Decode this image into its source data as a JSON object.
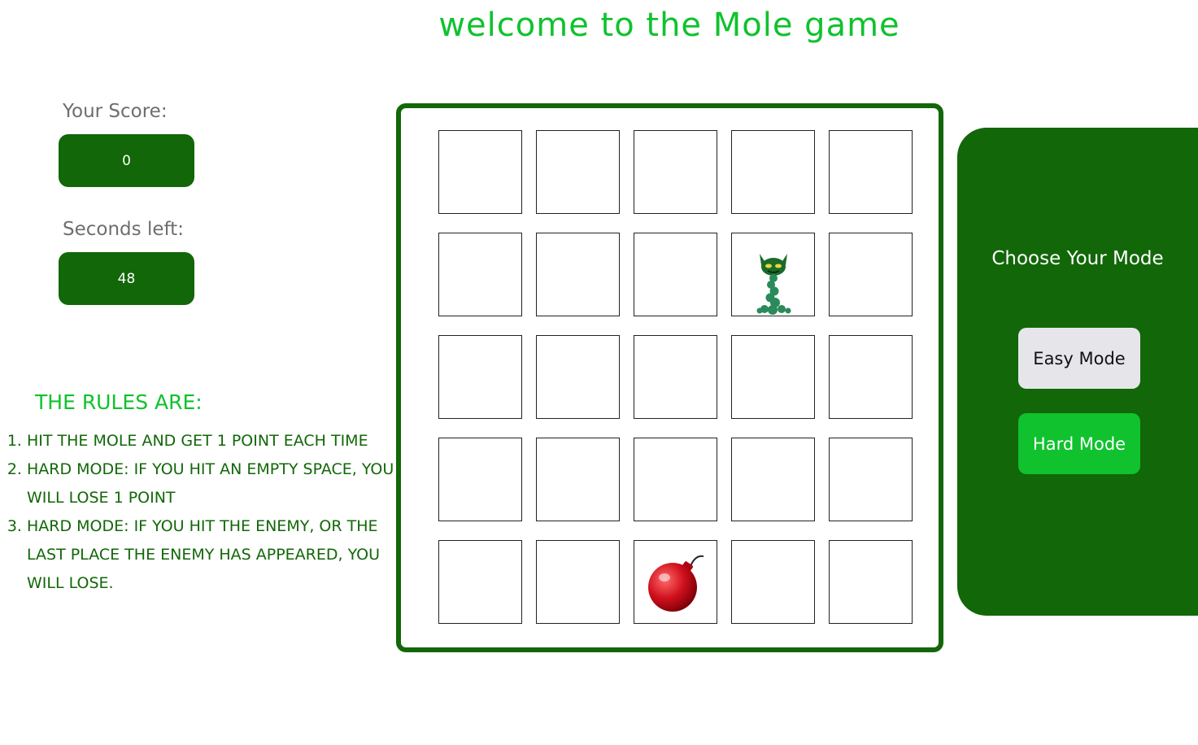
{
  "title": "welcome to the Mole game",
  "score": {
    "label": "Your Score:",
    "value": "0"
  },
  "timer": {
    "label": "Seconds left:",
    "value": "48"
  },
  "rules": {
    "title": "The rules are:",
    "items": [
      "Hit the mole and get 1 point each time",
      "Hard mode: if you hit an empty space, you will lose 1 point",
      "Hard mode: if you hit the enemy, or the last place the enemy has appeared, you will lose."
    ]
  },
  "board": {
    "rows": 5,
    "cols": 5,
    "mole": {
      "row": 2,
      "col": 4
    },
    "enemy": {
      "row": 5,
      "col": 3
    },
    "mole_icon": "mole-icon",
    "enemy_icon": "bomb-icon"
  },
  "mode_panel": {
    "title": "Choose Your Mode",
    "easy_label": "Easy Mode",
    "hard_label": "Hard Mode"
  },
  "colors": {
    "dark_green": "#126708",
    "bright_green": "#0fc22e",
    "gray": "#6e6e6e",
    "easy_button": "#e6e6ea"
  }
}
